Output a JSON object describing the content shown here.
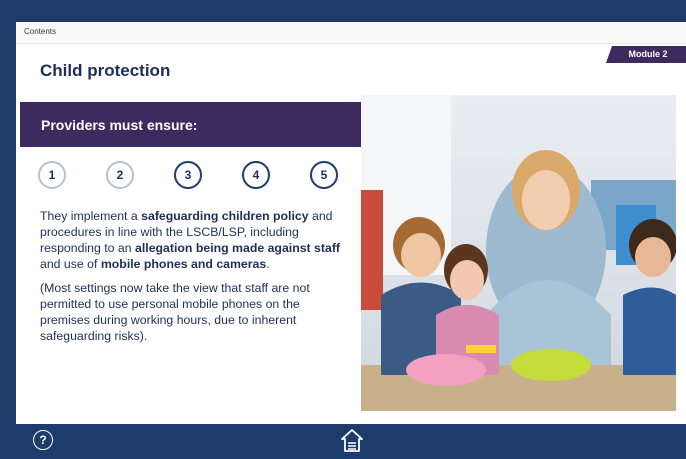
{
  "nav": {
    "contents_label": "Contents"
  },
  "module": {
    "label": "Module 2"
  },
  "page": {
    "title": "Child protection"
  },
  "banner": {
    "text": "Providers must ensure:"
  },
  "steps": {
    "items": [
      "1",
      "2",
      "3",
      "4",
      "5"
    ],
    "active": [
      3,
      4,
      5
    ]
  },
  "body": {
    "p1_a": "They implement a ",
    "p1_b": "safeguarding children policy",
    "p1_c": " and procedures in line with the LSCB/LSP, including responding to an ",
    "p1_d": "allegation being made against staff",
    "p1_e": " and use of ",
    "p1_f": "mobile phones and cameras",
    "p1_g": ".",
    "p2": "(Most settings now take the view that staff are not permitted to use personal mobile phones on the premises during working hours, due to inherent safeguarding risks)."
  },
  "footer": {
    "help_label": "?",
    "home_icon": "home-icon"
  },
  "colors": {
    "navy": "#1d3b6b",
    "purple": "#3d2a5e",
    "title": "#1d2f57"
  }
}
